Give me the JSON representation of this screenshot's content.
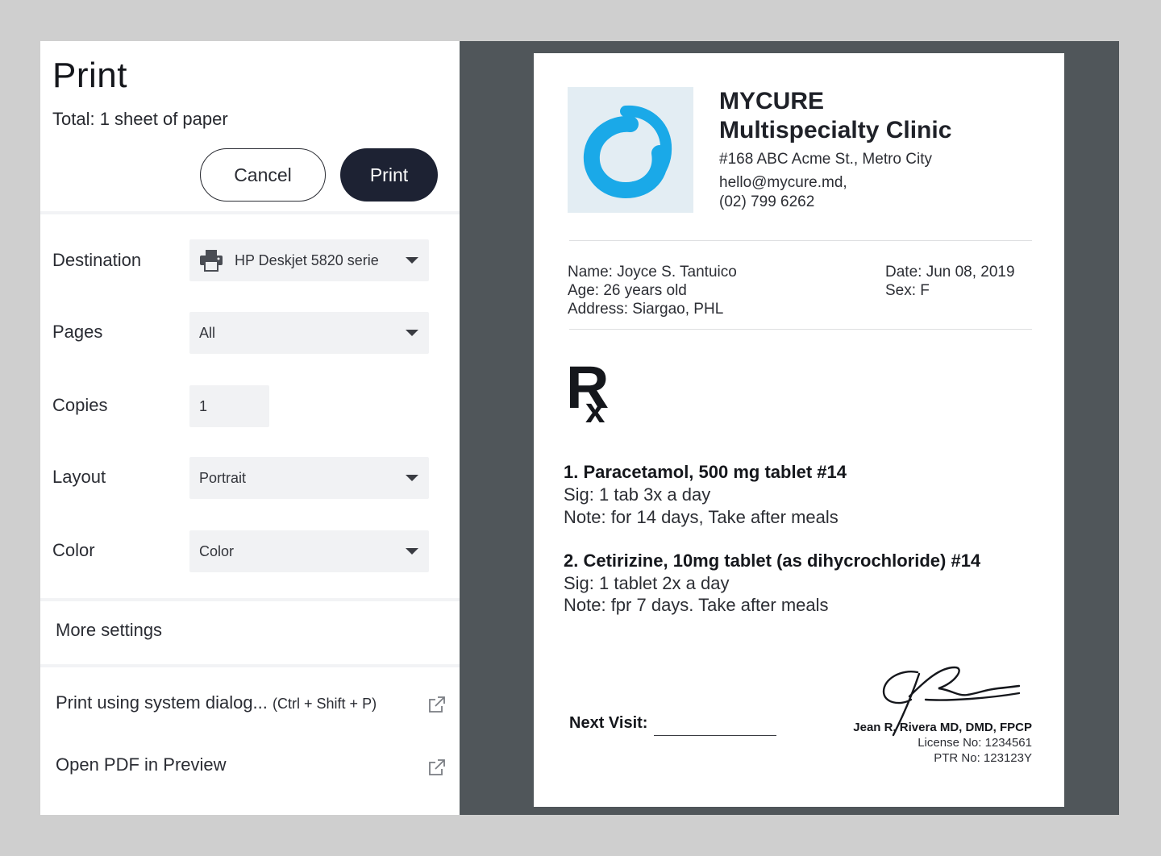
{
  "dialog": {
    "title": "Print",
    "total": "Total: 1 sheet of paper",
    "cancel_label": "Cancel",
    "print_label": "Print"
  },
  "settings": {
    "destination": {
      "label": "Destination",
      "value": "HP Deskjet 5820 serie"
    },
    "pages": {
      "label": "Pages",
      "value": "All"
    },
    "copies": {
      "label": "Copies",
      "value": "1"
    },
    "layout": {
      "label": "Layout",
      "value": "Portrait"
    },
    "color": {
      "label": "Color",
      "value": "Color"
    }
  },
  "more_settings": "More settings",
  "system_dialog": {
    "label": "Print using system dialog...",
    "shortcut": "(Ctrl + Shift + P)"
  },
  "open_pdf": "Open PDF in Preview",
  "prescription": {
    "clinic_name_1": "MYCURE",
    "clinic_name_2": "Multispecialty Clinic",
    "address": "#168 ABC Acme St., Metro City",
    "email": "hello@mycure.md,",
    "phone": "(02) 799 6262",
    "patient_name": "Name: Joyce S. Tantuico",
    "patient_age": "Age: 26 years old",
    "patient_address": "Address: Siargao, PHL",
    "date": "Date: Jun 08, 2019",
    "sex": "Sex: F",
    "rx_symbol": "Rx",
    "meds": [
      {
        "title": "1. Paracetamol, 500 mg tablet #14",
        "sig": "Sig: 1 tab 3x a day",
        "note": "Note: for 14 days, Take after meals"
      },
      {
        "title": "2. Cetirizine, 10mg tablet (as dihycrochloride) #14",
        "sig": "Sig: 1 tablet 2x a day",
        "note": "Note: fpr 7 days. Take after meals"
      }
    ],
    "next_visit": "Next Visit:",
    "doctor_name": "Jean R. Rivera MD, DMD, FPCP",
    "license": "License No: 1234561",
    "ptr": "PTR No: 123123Y"
  },
  "colors": {
    "print_button": "#1d2233",
    "preview_bg": "#50565a",
    "logo_blue": "#1aa9e8",
    "logo_bg": "#e3edf3"
  }
}
